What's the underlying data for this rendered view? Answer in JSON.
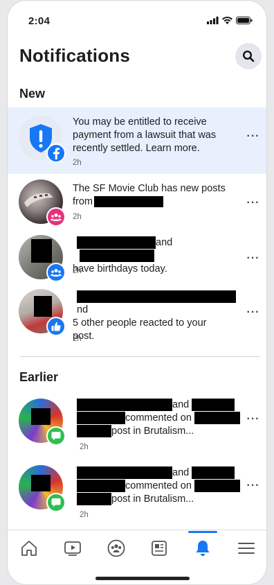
{
  "status_bar": {
    "time": "2:04"
  },
  "header": {
    "title": "Notifications"
  },
  "sections": {
    "new": "New",
    "earlier": "Earlier"
  },
  "notifications": [
    {
      "text": "You may be entitled to receive payment from a lawsuit that was recently settled. Learn more.",
      "time": "2h",
      "more": "···"
    },
    {
      "line1": "The SF Movie Club has new posts",
      "line2": "from",
      "time": "2h",
      "more": "···"
    },
    {
      "line1_suffix": "and",
      "line2": "have birthdays today.",
      "time": "2h",
      "more": "···"
    },
    {
      "line1_suffix": "nd",
      "line2": "5 other people reacted to your",
      "line3": "post.",
      "time": "2h",
      "more": "···"
    },
    {
      "line1_suffix": "and",
      "line2": "commented on",
      "line3": "post in Brutalism...",
      "time": "2h",
      "more": "···"
    },
    {
      "line1_suffix": "and",
      "line2": "commented on",
      "line3": "post in Brutalism...",
      "time": "2h",
      "more": "···"
    }
  ],
  "icons": {
    "search": "search-icon",
    "badges": [
      "facebook-icon",
      "group-icon",
      "group-icon",
      "like-icon",
      "comment-icon",
      "comment-icon"
    ],
    "nav": [
      "home-icon",
      "video-icon",
      "groups-icon",
      "news-feed-icon",
      "bell-icon",
      "menu-icon"
    ]
  },
  "colors": {
    "accent": "#1877f2",
    "highlight_row": "#e7f0fc",
    "group_badge_pink": "#e4327a",
    "comment_badge_green": "#2fbf4f"
  }
}
